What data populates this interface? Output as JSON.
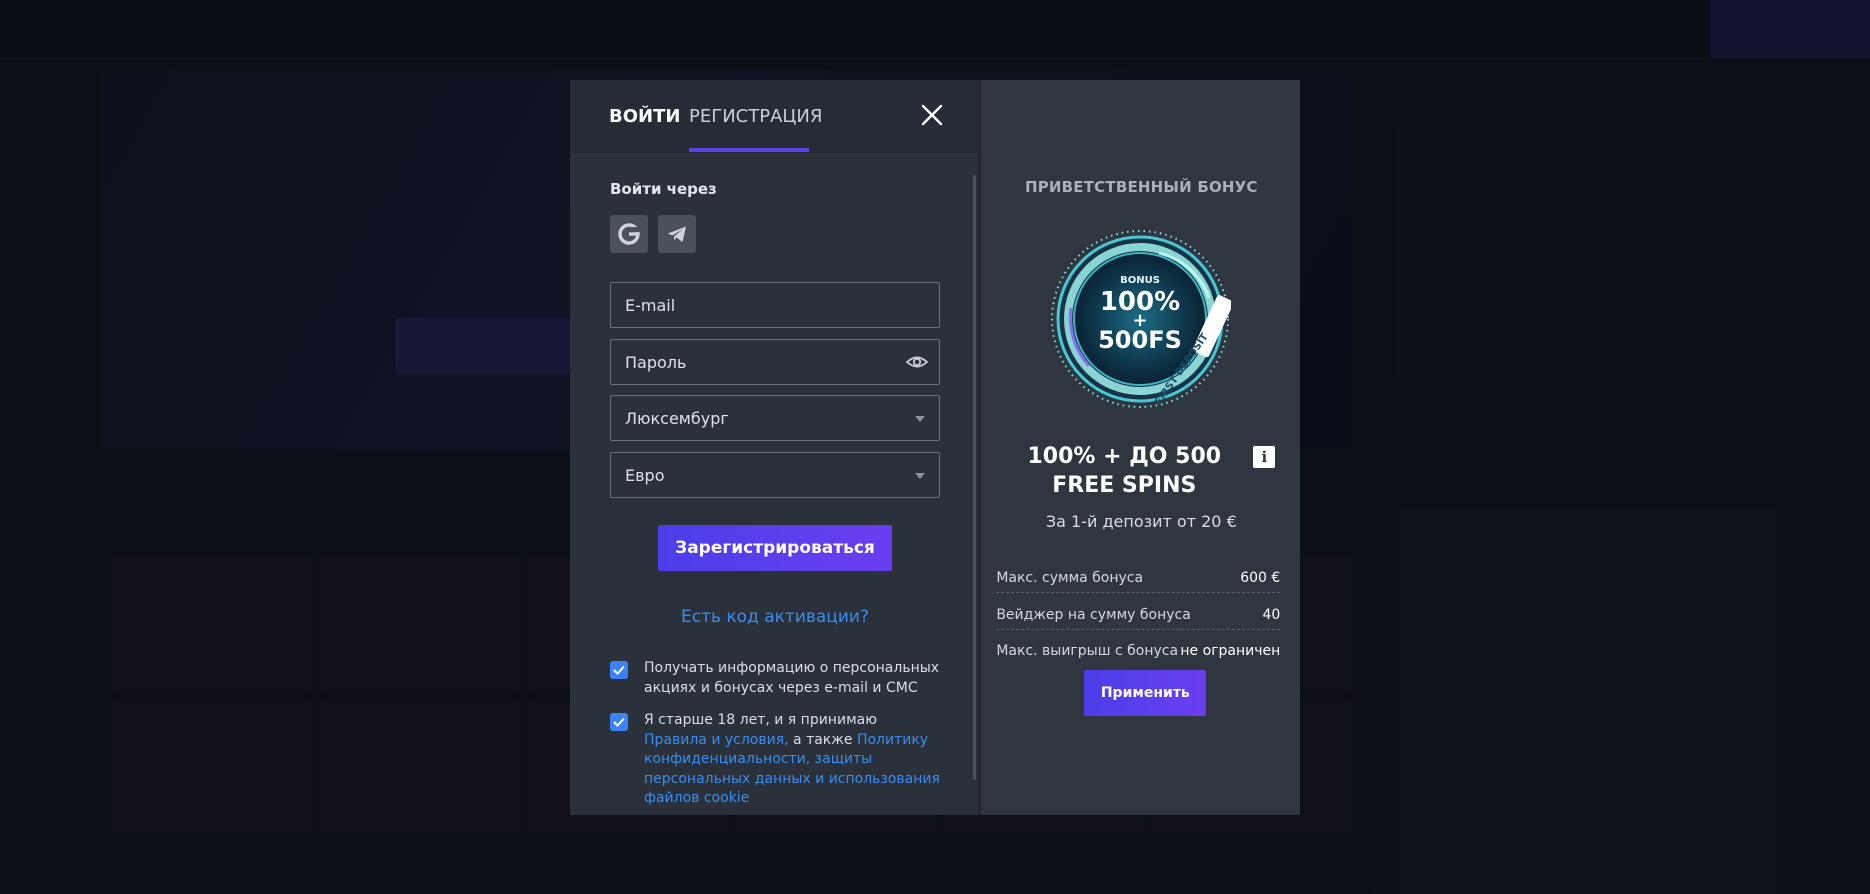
{
  "modal": {
    "tabs": {
      "login": "ВОЙТИ",
      "register": "РЕГИСТРАЦИЯ"
    },
    "login_with": "Войти через",
    "social": [
      "google-icon",
      "telegram-icon"
    ],
    "fields": {
      "email_placeholder": "E-mail",
      "password_placeholder": "Пароль",
      "country_value": "Люксембург",
      "currency_value": "Евро"
    },
    "register_button": "Зарегистрироваться",
    "activation_link": "Есть код активации?",
    "checkbox1": {
      "checked": true,
      "text": "Получать информацию о персональных акциях и бонусах через e-mail и СМС"
    },
    "checkbox2": {
      "checked": true,
      "text_prefix": "Я старше 18 лет, и я принимаю ",
      "link_terms": "Правила и условия,",
      "text_middle": " а также ",
      "link_privacy": "Политику конфиденциальности, защиты персональных данных и использования файлов cookie"
    }
  },
  "bonus": {
    "heading": "ПРИВЕТСТВЕННЫЙ БОНУС",
    "badge": {
      "top": "BONUS",
      "line1": "100%",
      "plus": "+",
      "line2": "500FS",
      "ring": "FIRST DEPOSIT"
    },
    "title": "100% + ДО 500 FREE SPINS",
    "info_label": "i",
    "subtitle": "За 1-й депозит от 20 €",
    "rows": [
      {
        "label": "Макс. сумма бонуса",
        "value": "600 €"
      },
      {
        "label": "Вейджер на сумму бонуса",
        "value": "40"
      },
      {
        "label": "Макс. выигрыш с бонуса",
        "value": "не ограничен"
      }
    ],
    "apply_button": "Применить"
  },
  "colors": {
    "accent": "#5a46e6",
    "link": "#3a8cf0",
    "checkbox": "#3b82f6"
  }
}
